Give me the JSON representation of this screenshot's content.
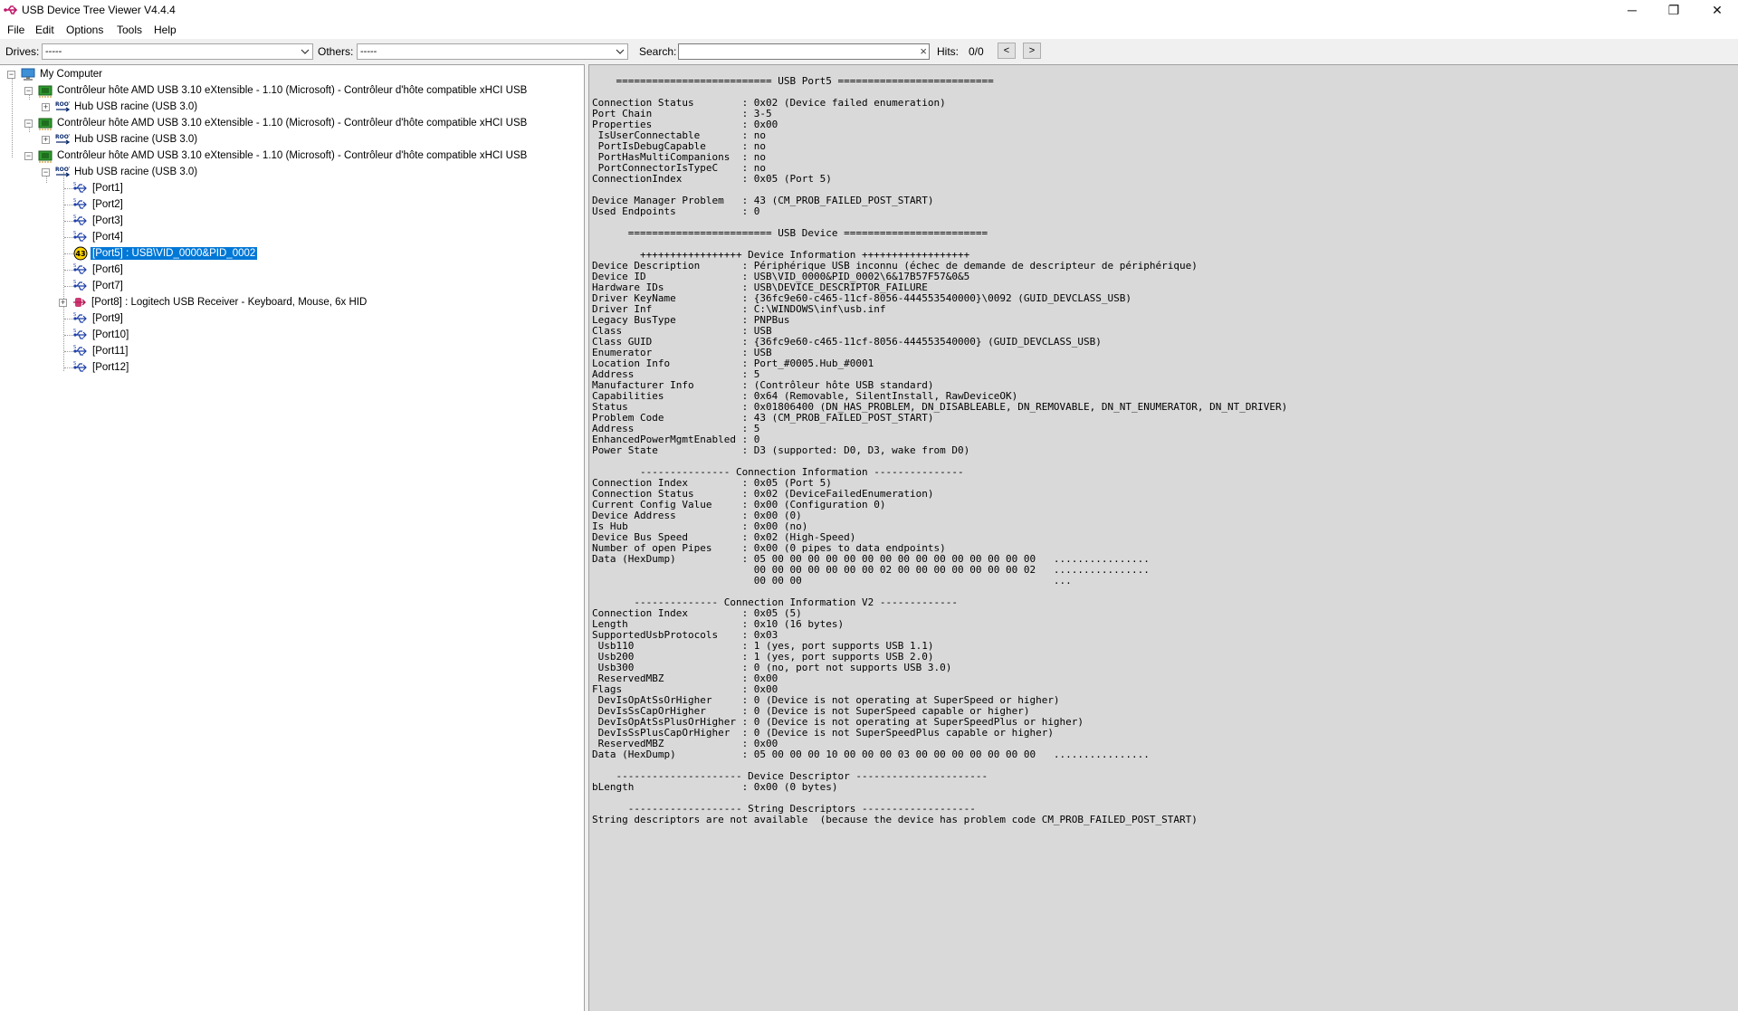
{
  "window": {
    "title": "USB Device Tree Viewer V4.4.4",
    "controls": {
      "minimize": "─",
      "maximize": "❐",
      "close": "✕"
    }
  },
  "menu": [
    "File",
    "Edit",
    "Options",
    "Tools",
    "Help"
  ],
  "toolbar": {
    "drives_label": "Drives:",
    "drives_value": "-----",
    "others_label": "Others:",
    "others_value": "-----",
    "search_label": "Search:",
    "search_value": "",
    "hits_label": "Hits:",
    "hits_value": "0/0",
    "prev": "<",
    "next": ">"
  },
  "tree": {
    "root": "My Computer",
    "controllers": [
      "Contrôleur hôte AMD USB 3.10 eXtensible - 1.10 (Microsoft) - Contrôleur d'hôte compatible xHCI USB",
      "Contrôleur hôte AMD USB 3.10 eXtensible - 1.10 (Microsoft) - Contrôleur d'hôte compatible xHCI USB",
      "Contrôleur hôte AMD USB 3.10 eXtensible - 1.10 (Microsoft) - Contrôleur d'hôte compatible xHCI USB"
    ],
    "hub": "Hub USB racine (USB 3.0)",
    "ports": [
      "[Port1]",
      "[Port2]",
      "[Port3]",
      "[Port4]",
      "[Port5] : USB\\VID_0000&PID_0002",
      "[Port6]",
      "[Port7]",
      "[Port8] : Logitech USB Receiver - Keyboard, Mouse, 6x HID",
      "[Port9]",
      "[Port10]",
      "[Port11]",
      "[Port12]"
    ],
    "port5_badge": "43"
  },
  "detail": {
    "lines": [
      "    ========================== USB Port5 ==========================",
      "",
      "Connection Status        : 0x02 (Device failed enumeration)",
      "Port Chain               : 3-5",
      "Properties               : 0x00",
      " IsUserConnectable       : no",
      " PortIsDebugCapable      : no",
      " PortHasMultiCompanions  : no",
      " PortConnectorIsTypeC    : no",
      "ConnectionIndex          : 0x05 (Port 5)",
      "",
      "Device Manager Problem   : 43 (CM_PROB_FAILED_POST_START)",
      "Used Endpoints           : 0",
      "",
      "      ======================== USB Device ========================",
      "",
      "        +++++++++++++++++ Device Information ++++++++++++++++++",
      "Device Description       : Périphérique USB inconnu (échec de demande de descripteur de périphérique)",
      "Device ID                : USB\\VID_0000&PID_0002\\6&17B57F57&0&5",
      "Hardware IDs             : USB\\DEVICE_DESCRIPTOR_FAILURE",
      "Driver KeyName           : {36fc9e60-c465-11cf-8056-444553540000}\\0092 (GUID_DEVCLASS_USB)",
      "Driver Inf               : C:\\WINDOWS\\inf\\usb.inf",
      "Legacy BusType           : PNPBus",
      "Class                    : USB",
      "Class GUID               : {36fc9e60-c465-11cf-8056-444553540000} (GUID_DEVCLASS_USB)",
      "Enumerator               : USB",
      "Location Info            : Port_#0005.Hub_#0001",
      "Address                  : 5",
      "Manufacturer Info        : (Contrôleur hôte USB standard)",
      "Capabilities             : 0x64 (Removable, SilentInstall, RawDeviceOK)",
      "Status                   : 0x01806400 (DN_HAS_PROBLEM, DN_DISABLEABLE, DN_REMOVABLE, DN_NT_ENUMERATOR, DN_NT_DRIVER)",
      "Problem Code             : 43 (CM_PROB_FAILED_POST_START)",
      "Address                  : 5",
      "EnhancedPowerMgmtEnabled : 0",
      "Power State              : D3 (supported: D0, D3, wake from D0)",
      "",
      "        --------------- Connection Information ---------------",
      "Connection Index         : 0x05 (Port 5)",
      "Connection Status        : 0x02 (DeviceFailedEnumeration)",
      "Current Config Value     : 0x00 (Configuration 0)",
      "Device Address           : 0x00 (0)",
      "Is Hub                   : 0x00 (no)",
      "Device Bus Speed         : 0x02 (High-Speed)",
      "Number of open Pipes     : 0x00 (0 pipes to data endpoints)",
      "Data (HexDump)           : 05 00 00 00 00 00 00 00 00 00 00 00 00 00 00 00   ................",
      "                           00 00 00 00 00 00 00 02 00 00 00 00 00 00 00 02   ................",
      "                           00 00 00                                          ...",
      "",
      "       -------------- Connection Information V2 -------------",
      "Connection Index         : 0x05 (5)",
      "Length                   : 0x10 (16 bytes)",
      "SupportedUsbProtocols    : 0x03",
      " Usb110                  : 1 (yes, port supports USB 1.1)",
      " Usb200                  : 1 (yes, port supports USB 2.0)",
      " Usb300                  : 0 (no, port not supports USB 3.0)",
      " ReservedMBZ             : 0x00",
      "Flags                    : 0x00",
      " DevIsOpAtSsOrHigher     : 0 (Device is not operating at SuperSpeed or higher)",
      " DevIsSsCapOrHigher      : 0 (Device is not SuperSpeed capable or higher)",
      " DevIsOpAtSsPlusOrHigher : 0 (Device is not operating at SuperSpeedPlus or higher)",
      " DevIsSsPlusCapOrHigher  : 0 (Device is not SuperSpeedPlus capable or higher)",
      " ReservedMBZ             : 0x00",
      "Data (HexDump)           : 05 00 00 00 10 00 00 00 03 00 00 00 00 00 00 00   ................",
      "",
      "    --------------------- Device Descriptor ----------------------",
      "bLength                  : 0x00 (0 bytes)",
      "",
      "      ------------------- String Descriptors -------------------",
      "String descriptors are not available  (because the device has problem code CM_PROB_FAILED_POST_START)"
    ]
  }
}
